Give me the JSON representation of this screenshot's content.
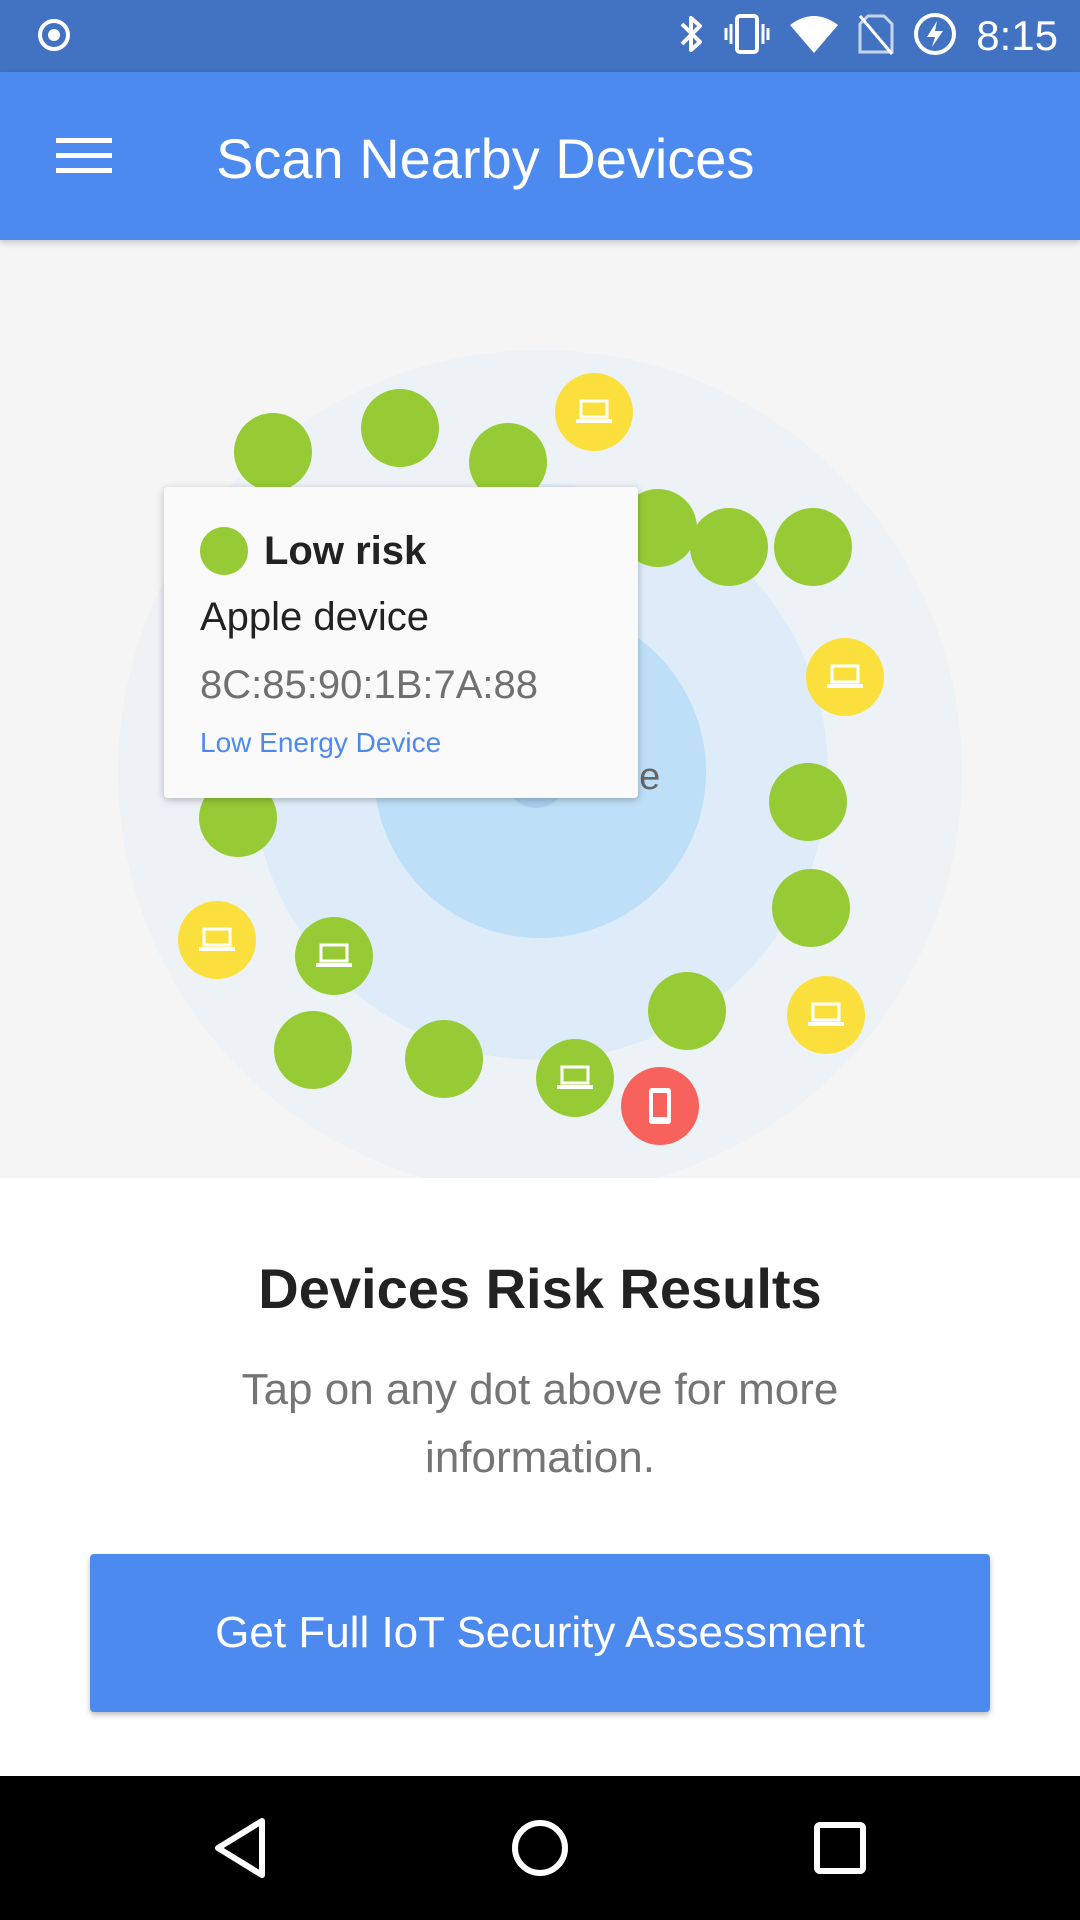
{
  "status_bar": {
    "time": "8:15",
    "icons": [
      "record-icon",
      "bluetooth-icon",
      "vibrate-icon",
      "wifi-icon",
      "no-sim-icon",
      "battery-charging-icon"
    ]
  },
  "app_bar": {
    "title": "Scan Nearby Devices",
    "menu_icon": "hamburger-menu-icon"
  },
  "radar": {
    "center_label_visible_fragment": "ne",
    "colors": {
      "low": "#97cb35",
      "medium": "#fbe03d",
      "high": "#f7625c"
    },
    "devices": [
      {
        "risk": "low",
        "icon": ""
      },
      {
        "risk": "medium",
        "icon": "laptop-icon"
      },
      {
        "risk": "low",
        "icon": ""
      },
      {
        "risk": "low",
        "icon": ""
      },
      {
        "risk": "low",
        "icon": ""
      },
      {
        "risk": "low",
        "icon": ""
      },
      {
        "risk": "low",
        "icon": ""
      },
      {
        "risk": "medium",
        "icon": "laptop-icon"
      },
      {
        "risk": "low",
        "icon": ""
      },
      {
        "risk": "low",
        "icon": ""
      },
      {
        "risk": "medium",
        "icon": "laptop-icon"
      },
      {
        "risk": "low",
        "icon": "laptop-icon"
      },
      {
        "risk": "low",
        "icon": ""
      },
      {
        "risk": "low",
        "icon": ""
      },
      {
        "risk": "low",
        "icon": ""
      },
      {
        "risk": "low",
        "icon": ""
      },
      {
        "risk": "low",
        "icon": "laptop-icon"
      },
      {
        "risk": "medium",
        "icon": "laptop-icon"
      },
      {
        "risk": "high",
        "icon": "phone-icon"
      }
    ]
  },
  "tooltip": {
    "risk_label": "Low risk",
    "device_name": "Apple device",
    "mac_address": "8C:85:90:1B:7A:88",
    "device_type": "Low Energy Device"
  },
  "results": {
    "title": "Devices Risk Results",
    "subtitle": "Tap on any dot above for more information."
  },
  "cta": {
    "label": "Get Full IoT Security Assessment"
  },
  "nav_bar": {
    "icons": [
      "back-icon",
      "home-icon",
      "recents-icon"
    ]
  }
}
